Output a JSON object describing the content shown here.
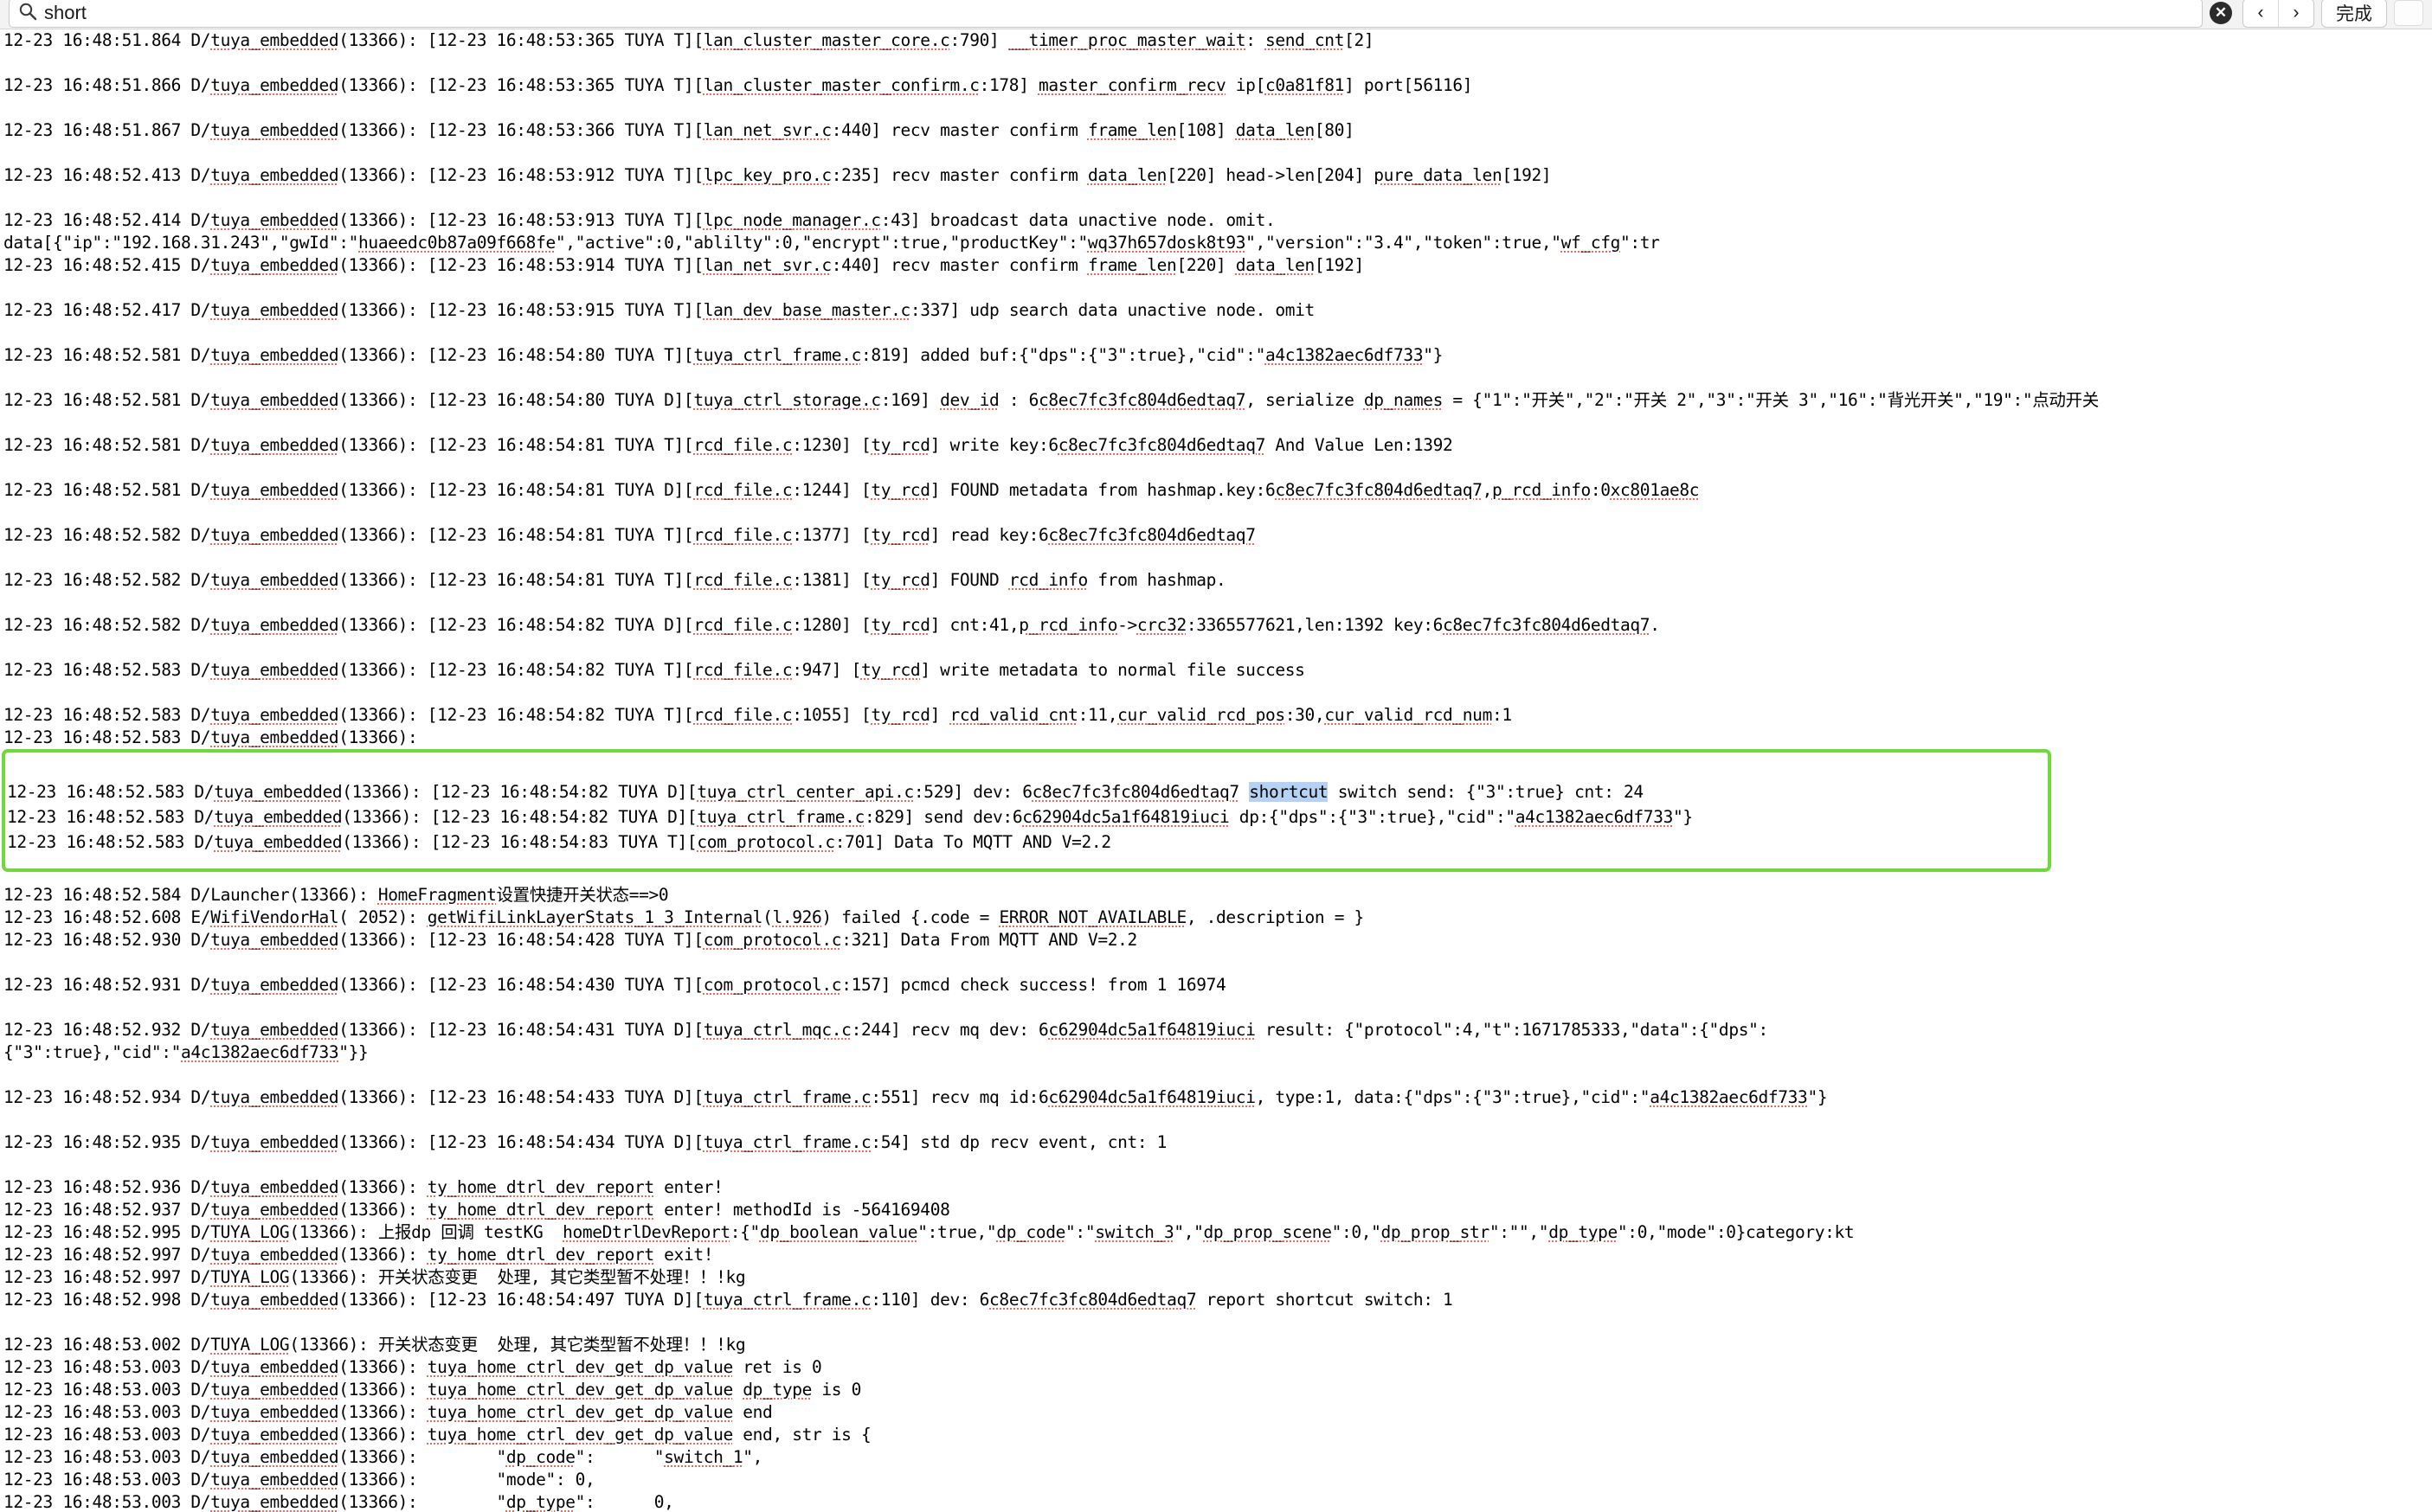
{
  "search": {
    "value": "short",
    "placeholder": "Search",
    "icon": "search-icon",
    "clear_label": "✕",
    "prev_label": "‹",
    "next_label": "›",
    "done_label": "完成"
  },
  "colors": {
    "highlight_box": "#6fd93b",
    "search_hit": "#b5d2f5",
    "spellcheck": "#ef6a5a",
    "text": "#000000",
    "background": "#ffffff",
    "toolbar": "#f3f3f3"
  },
  "log": {
    "lines": [
      {
        "text": "12-23 16:48:51.864 D/tuya_embedded(13366): [12-23 16:48:53:365 TUYA T][lan_cluster_master_core.c:790] __timer_proc_master_wait: send_cnt[2]",
        "clipped_top": true
      },
      {
        "text": ""
      },
      {
        "text": "12-23 16:48:51.866 D/tuya_embedded(13366): [12-23 16:48:53:365 TUYA T][lan_cluster_master_confirm.c:178] master_confirm_recv ip[c0a81f81] port[56116]"
      },
      {
        "text": ""
      },
      {
        "text": "12-23 16:48:51.867 D/tuya_embedded(13366): [12-23 16:48:53:366 TUYA T][lan_net_svr.c:440] recv master confirm frame_len[108] data_len[80]"
      },
      {
        "text": ""
      },
      {
        "text": "12-23 16:48:52.413 D/tuya_embedded(13366): [12-23 16:48:53:912 TUYA T][lpc_key_pro.c:235] recv master confirm data_len[220] head->len[204] pure_data_len[192]"
      },
      {
        "text": ""
      },
      {
        "text": "12-23 16:48:52.414 D/tuya_embedded(13366): [12-23 16:48:53:913 TUYA T][lpc_node_manager.c:43] broadcast data unactive node. omit."
      },
      {
        "text": "data[{\"ip\":\"192.168.31.243\",\"gwId\":\"huaeedc0b87a09f668fe\",\"active\":0,\"ablilty\":0,\"encrypt\":true,\"productKey\":\"wq37h657dosk8t93\",\"version\":\"3.4\",\"token\":true,\"wf_cfg\":tr"
      },
      {
        "text": "12-23 16:48:52.415 D/tuya_embedded(13366): [12-23 16:48:53:914 TUYA T][lan_net_svr.c:440] recv master confirm frame_len[220] data_len[192]"
      },
      {
        "text": ""
      },
      {
        "text": "12-23 16:48:52.417 D/tuya_embedded(13366): [12-23 16:48:53:915 TUYA T][lan_dev_base_master.c:337] udp search data unactive node. omit"
      },
      {
        "text": ""
      },
      {
        "text": "12-23 16:48:52.581 D/tuya_embedded(13366): [12-23 16:48:54:80 TUYA T][tuya_ctrl_frame.c:819] added buf:{\"dps\":{\"3\":true},\"cid\":\"a4c1382aec6df733\"}"
      },
      {
        "text": ""
      },
      {
        "text": "12-23 16:48:52.581 D/tuya_embedded(13366): [12-23 16:48:54:80 TUYA D][tuya_ctrl_storage.c:169] dev_id : 6c8ec7fc3fc804d6edtaq7, serialize dp_names = {\"1\":\"开关\",\"2\":\"开关 2\",\"3\":\"开关 3\",\"16\":\"背光开关\",\"19\":\"点动开关"
      },
      {
        "text": ""
      },
      {
        "text": "12-23 16:48:52.581 D/tuya_embedded(13366): [12-23 16:48:54:81 TUYA T][rcd_file.c:1230] [ty_rcd] write key:6c8ec7fc3fc804d6edtaq7 And Value Len:1392"
      },
      {
        "text": ""
      },
      {
        "text": "12-23 16:48:52.581 D/tuya_embedded(13366): [12-23 16:48:54:81 TUYA D][rcd_file.c:1244] [ty_rcd] FOUND metadata from hashmap.key:6c8ec7fc3fc804d6edtaq7,p_rcd_info:0xc801ae8c"
      },
      {
        "text": ""
      },
      {
        "text": "12-23 16:48:52.582 D/tuya_embedded(13366): [12-23 16:48:54:81 TUYA T][rcd_file.c:1377] [ty_rcd] read key:6c8ec7fc3fc804d6edtaq7"
      },
      {
        "text": ""
      },
      {
        "text": "12-23 16:48:52.582 D/tuya_embedded(13366): [12-23 16:48:54:81 TUYA T][rcd_file.c:1381] [ty_rcd] FOUND rcd_info from hashmap."
      },
      {
        "text": ""
      },
      {
        "text": "12-23 16:48:52.582 D/tuya_embedded(13366): [12-23 16:48:54:82 TUYA D][rcd_file.c:1280] [ty_rcd] cnt:41,p_rcd_info->crc32:3365577621,len:1392 key:6c8ec7fc3fc804d6edtaq7."
      },
      {
        "text": ""
      },
      {
        "text": "12-23 16:48:52.583 D/tuya_embedded(13366): [12-23 16:48:54:82 TUYA T][rcd_file.c:947] [ty_rcd] write metadata to normal file success"
      },
      {
        "text": ""
      },
      {
        "text": "12-23 16:48:52.583 D/tuya_embedded(13366): [12-23 16:48:54:82 TUYA T][rcd_file.c:1055] [ty_rcd] rcd_valid_cnt:11,cur_valid_rcd_pos:30,cur_valid_rcd_num:1"
      },
      {
        "text": "12-23 16:48:52.583 D/tuya_embedded(13366):"
      },
      {
        "text": "",
        "is_box_gap": true
      },
      {
        "text": "",
        "is_box_gap": true
      },
      {
        "text": "",
        "is_box_gap": true
      },
      {
        "text": "",
        "is_box_gap": true
      },
      {
        "text": "",
        "is_box_gap": true
      },
      {
        "text": "",
        "is_box_gap": true
      },
      {
        "text": "12-23 16:48:52.584 D/Launcher(13366): HomeFragment设置快捷开关状态==>0"
      },
      {
        "text": "12-23 16:48:52.608 E/WifiVendorHal( 2052): getWifiLinkLayerStats_1_3_Internal(l.926) failed {.code = ERROR_NOT_AVAILABLE, .description = }"
      },
      {
        "text": "12-23 16:48:52.930 D/tuya_embedded(13366): [12-23 16:48:54:428 TUYA T][com_protocol.c:321] Data From MQTT AND V=2.2"
      },
      {
        "text": ""
      },
      {
        "text": "12-23 16:48:52.931 D/tuya_embedded(13366): [12-23 16:48:54:430 TUYA T][com_protocol.c:157] pcmcd check success! from 1 16974"
      },
      {
        "text": ""
      },
      {
        "text": "12-23 16:48:52.932 D/tuya_embedded(13366): [12-23 16:48:54:431 TUYA D][tuya_ctrl_mqc.c:244] recv mq dev: 6c62904dc5a1f64819iuci result: {\"protocol\":4,\"t\":1671785333,\"data\":{\"dps\":"
      },
      {
        "text": "{\"3\":true},\"cid\":\"a4c1382aec6df733\"}}"
      },
      {
        "text": ""
      },
      {
        "text": "12-23 16:48:52.934 D/tuya_embedded(13366): [12-23 16:48:54:433 TUYA D][tuya_ctrl_frame.c:551] recv mq id:6c62904dc5a1f64819iuci, type:1, data:{\"dps\":{\"3\":true},\"cid\":\"a4c1382aec6df733\"}"
      },
      {
        "text": ""
      },
      {
        "text": "12-23 16:48:52.935 D/tuya_embedded(13366): [12-23 16:48:54:434 TUYA D][tuya_ctrl_frame.c:54] std dp recv event, cnt: 1"
      },
      {
        "text": ""
      },
      {
        "text": "12-23 16:48:52.936 D/tuya_embedded(13366): ty_home_dtrl_dev_report enter!"
      },
      {
        "text": "12-23 16:48:52.937 D/tuya_embedded(13366): ty_home_dtrl_dev_report enter! methodId is -564169408"
      },
      {
        "text": "12-23 16:48:52.995 D/TUYA_LOG(13366): 上报dp 回调 testKG  homeDtrlDevReport:{\"dp_boolean_value\":true,\"dp_code\":\"switch_3\",\"dp_prop_scene\":0,\"dp_prop_str\":\"\",\"dp_type\":0,\"mode\":0}category:kt"
      },
      {
        "text": "12-23 16:48:52.997 D/tuya_embedded(13366): ty_home_dtrl_dev_report exit!"
      },
      {
        "text": "12-23 16:48:52.997 D/TUYA_LOG(13366): 开关状态变更  处理, 其它类型暂不处理！！!kg"
      },
      {
        "text": "12-23 16:48:52.998 D/tuya_embedded(13366): [12-23 16:48:54:497 TUYA D][tuya_ctrl_frame.c:110] dev: 6c8ec7fc3fc804d6edtaq7 report shortcut switch: 1"
      },
      {
        "text": ""
      },
      {
        "text": "12-23 16:48:53.002 D/TUYA_LOG(13366): 开关状态变更  处理, 其它类型暂不处理！！!kg"
      },
      {
        "text": "12-23 16:48:53.003 D/tuya_embedded(13366): tuya_home_ctrl_dev_get_dp_value ret is 0"
      },
      {
        "text": "12-23 16:48:53.003 D/tuya_embedded(13366): tuya_home_ctrl_dev_get_dp_value dp_type is 0"
      },
      {
        "text": "12-23 16:48:53.003 D/tuya_embedded(13366): tuya_home_ctrl_dev_get_dp_value end"
      },
      {
        "text": "12-23 16:48:53.003 D/tuya_embedded(13366): tuya_home_ctrl_dev_get_dp_value end, str is {"
      },
      {
        "text": "12-23 16:48:53.003 D/tuya_embedded(13366):        \"dp_code\":      \"switch_1\","
      },
      {
        "text": "12-23 16:48:53.003 D/tuya_embedded(13366):        \"mode\": 0,"
      },
      {
        "text": "12-23 16:48:53.003 D/tuya_embedded(13366):        \"dp_type\":      0,",
        "clipped_bottom": true
      }
    ],
    "highlighted_group": {
      "border_color": "#6fd93b",
      "lines": [
        "12-23 16:48:52.583 D/tuya_embedded(13366): [12-23 16:48:54:82 TUYA D][tuya_ctrl_center_api.c:529] dev: 6c8ec7fc3fc804d6edtaq7 shortcut switch send: {\"3\":true} cnt: 24",
        "12-23 16:48:52.583 D/tuya_embedded(13366): [12-23 16:48:54:82 TUYA D][tuya_ctrl_frame.c:829] send dev:6c62904dc5a1f64819iuci dp:{\"dps\":{\"3\":true},\"cid\":\"a4c1382aec6df733\"}",
        "12-23 16:48:52.583 D/tuya_embedded(13366): [12-23 16:48:54:83 TUYA T][com_protocol.c:701] Data To MQTT AND V=2.2"
      ],
      "match_term": "shortcut"
    }
  }
}
